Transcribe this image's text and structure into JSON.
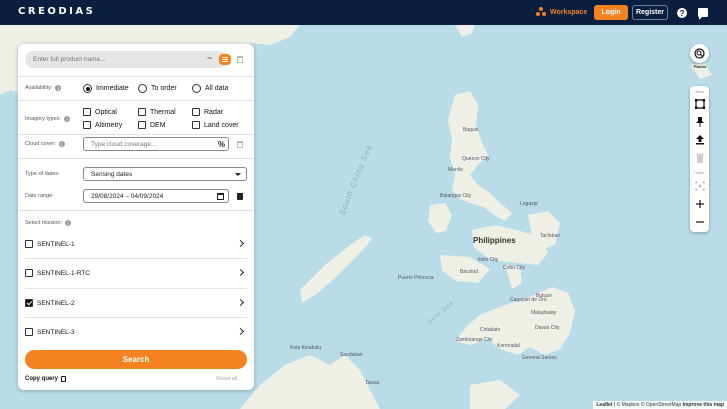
{
  "header": {
    "logo": "CREODIAS",
    "workspace": "Workspace",
    "login": "Login",
    "register": "Register",
    "help_icon": "question-circle-icon",
    "chat_icon": "chat-bubble-icon"
  },
  "panel": {
    "search": {
      "placeholder": "Enter full product name...",
      "value": ""
    },
    "availability": {
      "label": "Availability:",
      "options": [
        "Immediate",
        "To order",
        "All data"
      ],
      "selected": "Immediate"
    },
    "imagery": {
      "label": "Imagery types:",
      "options": [
        {
          "label": "Optical",
          "checked": false
        },
        {
          "label": "Thermal",
          "checked": false
        },
        {
          "label": "Radar",
          "checked": false
        },
        {
          "label": "Altimetry",
          "checked": false
        },
        {
          "label": "DEM",
          "checked": false
        },
        {
          "label": "Land cover",
          "checked": false
        }
      ]
    },
    "cloud": {
      "label": "Cloud cover:",
      "placeholder": "Type cloud coverage...",
      "value": "",
      "suffix": "%"
    },
    "dates_type": {
      "label": "Type of dates:",
      "value": "Sensing dates"
    },
    "date_range": {
      "label": "Date range:",
      "value": "29/08/2024 – 04/09/2024"
    },
    "missions": {
      "label": "Select mission:",
      "items": [
        {
          "label": "SENTINEL-1",
          "checked": false
        },
        {
          "label": "SENTINEL-1-RTC",
          "checked": false
        },
        {
          "label": "SENTINEL-2",
          "checked": true
        },
        {
          "label": "SENTINEL-3",
          "checked": false
        }
      ]
    },
    "search_button": "Search",
    "copy_query": "Copy query",
    "reset_all": "Reset all"
  },
  "map": {
    "places_label": "Places",
    "area_label": "Area",
    "view_label": "View",
    "country": "Philippines",
    "seas": [
      "South China Sea",
      "Sulu Sea"
    ],
    "cities": [
      "Baguio",
      "Quezon City",
      "Manila",
      "Batangas City",
      "Legazpi",
      "Tacloban",
      "Iloilo City",
      "Cebu City",
      "Bacolod",
      "Puerto Princesa",
      "Cagayan de Oro",
      "Davao City",
      "Zamboanga City",
      "General Santos",
      "Butuan",
      "Malaybalay",
      "Koronadal",
      "Kota Kinabalu",
      "Sandakan",
      "Tawau",
      "Cotabato"
    ],
    "attribution": {
      "leaflet": "Leaflet",
      "mapbox": "© Mapbox",
      "osm": "© OpenStreetMap",
      "improve": "Improve this map"
    }
  }
}
